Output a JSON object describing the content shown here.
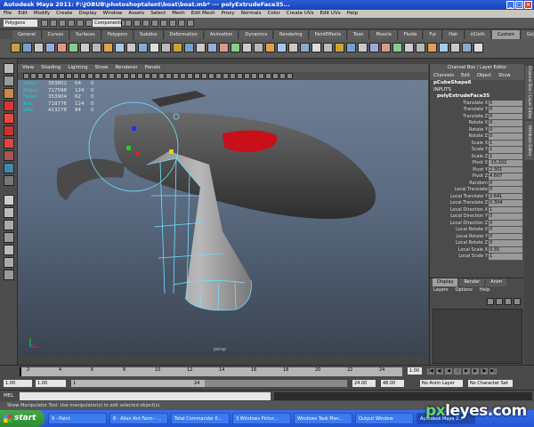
{
  "window": {
    "title": "Autodesk Maya 2011: F:\\JOBUB\\photoshoptalent\\boat\\boat.mb* --- polyExtrudeFace35..."
  },
  "menubar": [
    "File",
    "Edit",
    "Modify",
    "Create",
    "Display",
    "Window",
    "Assets",
    "Select",
    "Mesh",
    "Edit Mesh",
    "Proxy",
    "Normals",
    "Color",
    "Create UVs",
    "Edit UVs",
    "Help"
  ],
  "statusline": {
    "mode": "Polygons",
    "selection_field": "Components"
  },
  "shelf_tabs": [
    "General",
    "Curves",
    "Surfaces",
    "Polygons",
    "Subdivs",
    "Deformation",
    "Animation",
    "Dynamics",
    "Rendering",
    "PaintEffects",
    "Toon",
    "Muscle",
    "Fluids",
    "Fur",
    "Hair",
    "nCloth",
    "Custom",
    "GoZBrush"
  ],
  "shelf_active": "Custom",
  "viewport_menu": [
    "View",
    "Shading",
    "Lighting",
    "Show",
    "Renderer",
    "Panels"
  ],
  "hud": [
    {
      "label": "Verts:",
      "v1": "363802",
      "v2": "64",
      "v3": "0"
    },
    {
      "label": "Edges:",
      "v1": "717598",
      "v2": "124",
      "v3": "0"
    },
    {
      "label": "Faces:",
      "v1": "353904",
      "v2": "62",
      "v3": "0"
    },
    {
      "label": "Tris:",
      "v1": "718776",
      "v2": "124",
      "v3": "0"
    },
    {
      "label": "UVs:",
      "v1": "413278",
      "v2": "84",
      "v3": "0"
    }
  ],
  "viewport_label": "persp",
  "channelbox": {
    "title": "Channel Box / Layer Editor",
    "menu": [
      "Channels",
      "Edit",
      "Object",
      "Show"
    ],
    "shape": "pCubeShape6",
    "inputs": "INPUTS",
    "node": "polyExtrudeFace35",
    "attributes": [
      {
        "name": "Translate X",
        "value": "0"
      },
      {
        "name": "Translate Y",
        "value": "0"
      },
      {
        "name": "Translate Z",
        "value": "0"
      },
      {
        "name": "Rotate X",
        "value": "0"
      },
      {
        "name": "Rotate Y",
        "value": "0"
      },
      {
        "name": "Rotate Z",
        "value": "0"
      },
      {
        "name": "Scale X",
        "value": "1"
      },
      {
        "name": "Scale Y",
        "value": "1"
      },
      {
        "name": "Scale Z",
        "value": "1"
      },
      {
        "name": "Pivot X",
        "value": "-15.202"
      },
      {
        "name": "Pivot Y",
        "value": "2.301"
      },
      {
        "name": "Pivot Z",
        "value": "4.607"
      },
      {
        "name": "Random",
        "value": "0"
      },
      {
        "name": "Local Translate",
        "value": "0"
      },
      {
        "name": "Local Translate Y",
        "value": "2.641"
      },
      {
        "name": "Local Translate Z",
        "value": "0.304"
      },
      {
        "name": "Local Direction X",
        "value": "1"
      },
      {
        "name": "Local Direction Y",
        "value": "0"
      },
      {
        "name": "Local Direction Z",
        "value": "0"
      },
      {
        "name": "Local Rotate X",
        "value": "0"
      },
      {
        "name": "Local Rotate Y",
        "value": "0"
      },
      {
        "name": "Local Rotate Z",
        "value": "0"
      },
      {
        "name": "Local Scale X",
        "value": "0.35"
      },
      {
        "name": "Local Scale Y",
        "value": "1"
      }
    ]
  },
  "layer_panel": {
    "tabs": [
      "Display",
      "Render",
      "Anim"
    ],
    "active_tab": "Display",
    "menu": [
      "Layers",
      "Options",
      "Help"
    ]
  },
  "side_tabs": [
    "Channel Box / Layer Editor",
    "Attribute Editor"
  ],
  "timeslider": {
    "ticks": [
      "2",
      "4",
      "6",
      "8",
      "10",
      "12",
      "14",
      "16",
      "18",
      "20",
      "22",
      "24"
    ],
    "current_frame": "1.00"
  },
  "rangeslider": {
    "start": "1.00",
    "start2": "1.00",
    "thumb_value": "1",
    "thumb_end": "24",
    "end": "24.00",
    "end2": "48.00",
    "anim_layer": "No Anim Layer",
    "character_set": "No Character Set"
  },
  "cmdline": {
    "label": "MEL"
  },
  "helpline": "Show Manipulator Tool: Use manipulator(s) to edit selected object(s).",
  "taskbar": {
    "start": "start",
    "items": [
      "9 - Paint",
      "8 - Alien Ant Farm - ...",
      "Total Commander 6...",
      "3 Windows Pictur...",
      "Windows Task Man...",
      "Output Window",
      "Autodesk Maya 2..."
    ],
    "active_index": 6
  },
  "watermark": {
    "prefix": "px",
    "suffix": "leyes.com"
  },
  "colors": {
    "hud_label": "#00e0d0",
    "boat_body": "#4a4a4a",
    "cockpit": "#c8101a",
    "wireframe": "#6fe0ff",
    "shelf_active": "#a0a0a0"
  }
}
